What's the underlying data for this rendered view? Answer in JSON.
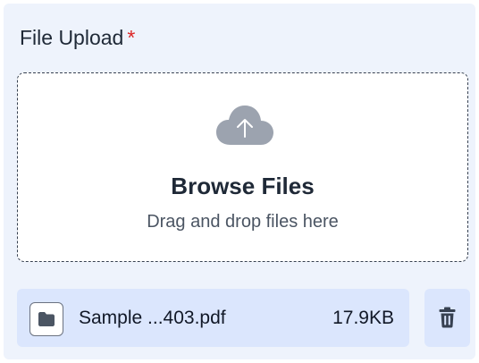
{
  "upload": {
    "label": "File Upload",
    "required_marker": "*",
    "dropzone": {
      "title": "Browse Files",
      "hint": "Drag and drop files here",
      "icon": "cloud-upload-icon"
    }
  },
  "files": [
    {
      "name": "Sample ...403.pdf",
      "size": "17.9KB",
      "type_icon": "folder-icon",
      "action_icon": "trash-icon"
    }
  ],
  "colors": {
    "panel_background": "#eef3fc",
    "file_row_background": "#dbe6fd",
    "required": "#dc2626",
    "icon_muted": "#9ca3af"
  }
}
